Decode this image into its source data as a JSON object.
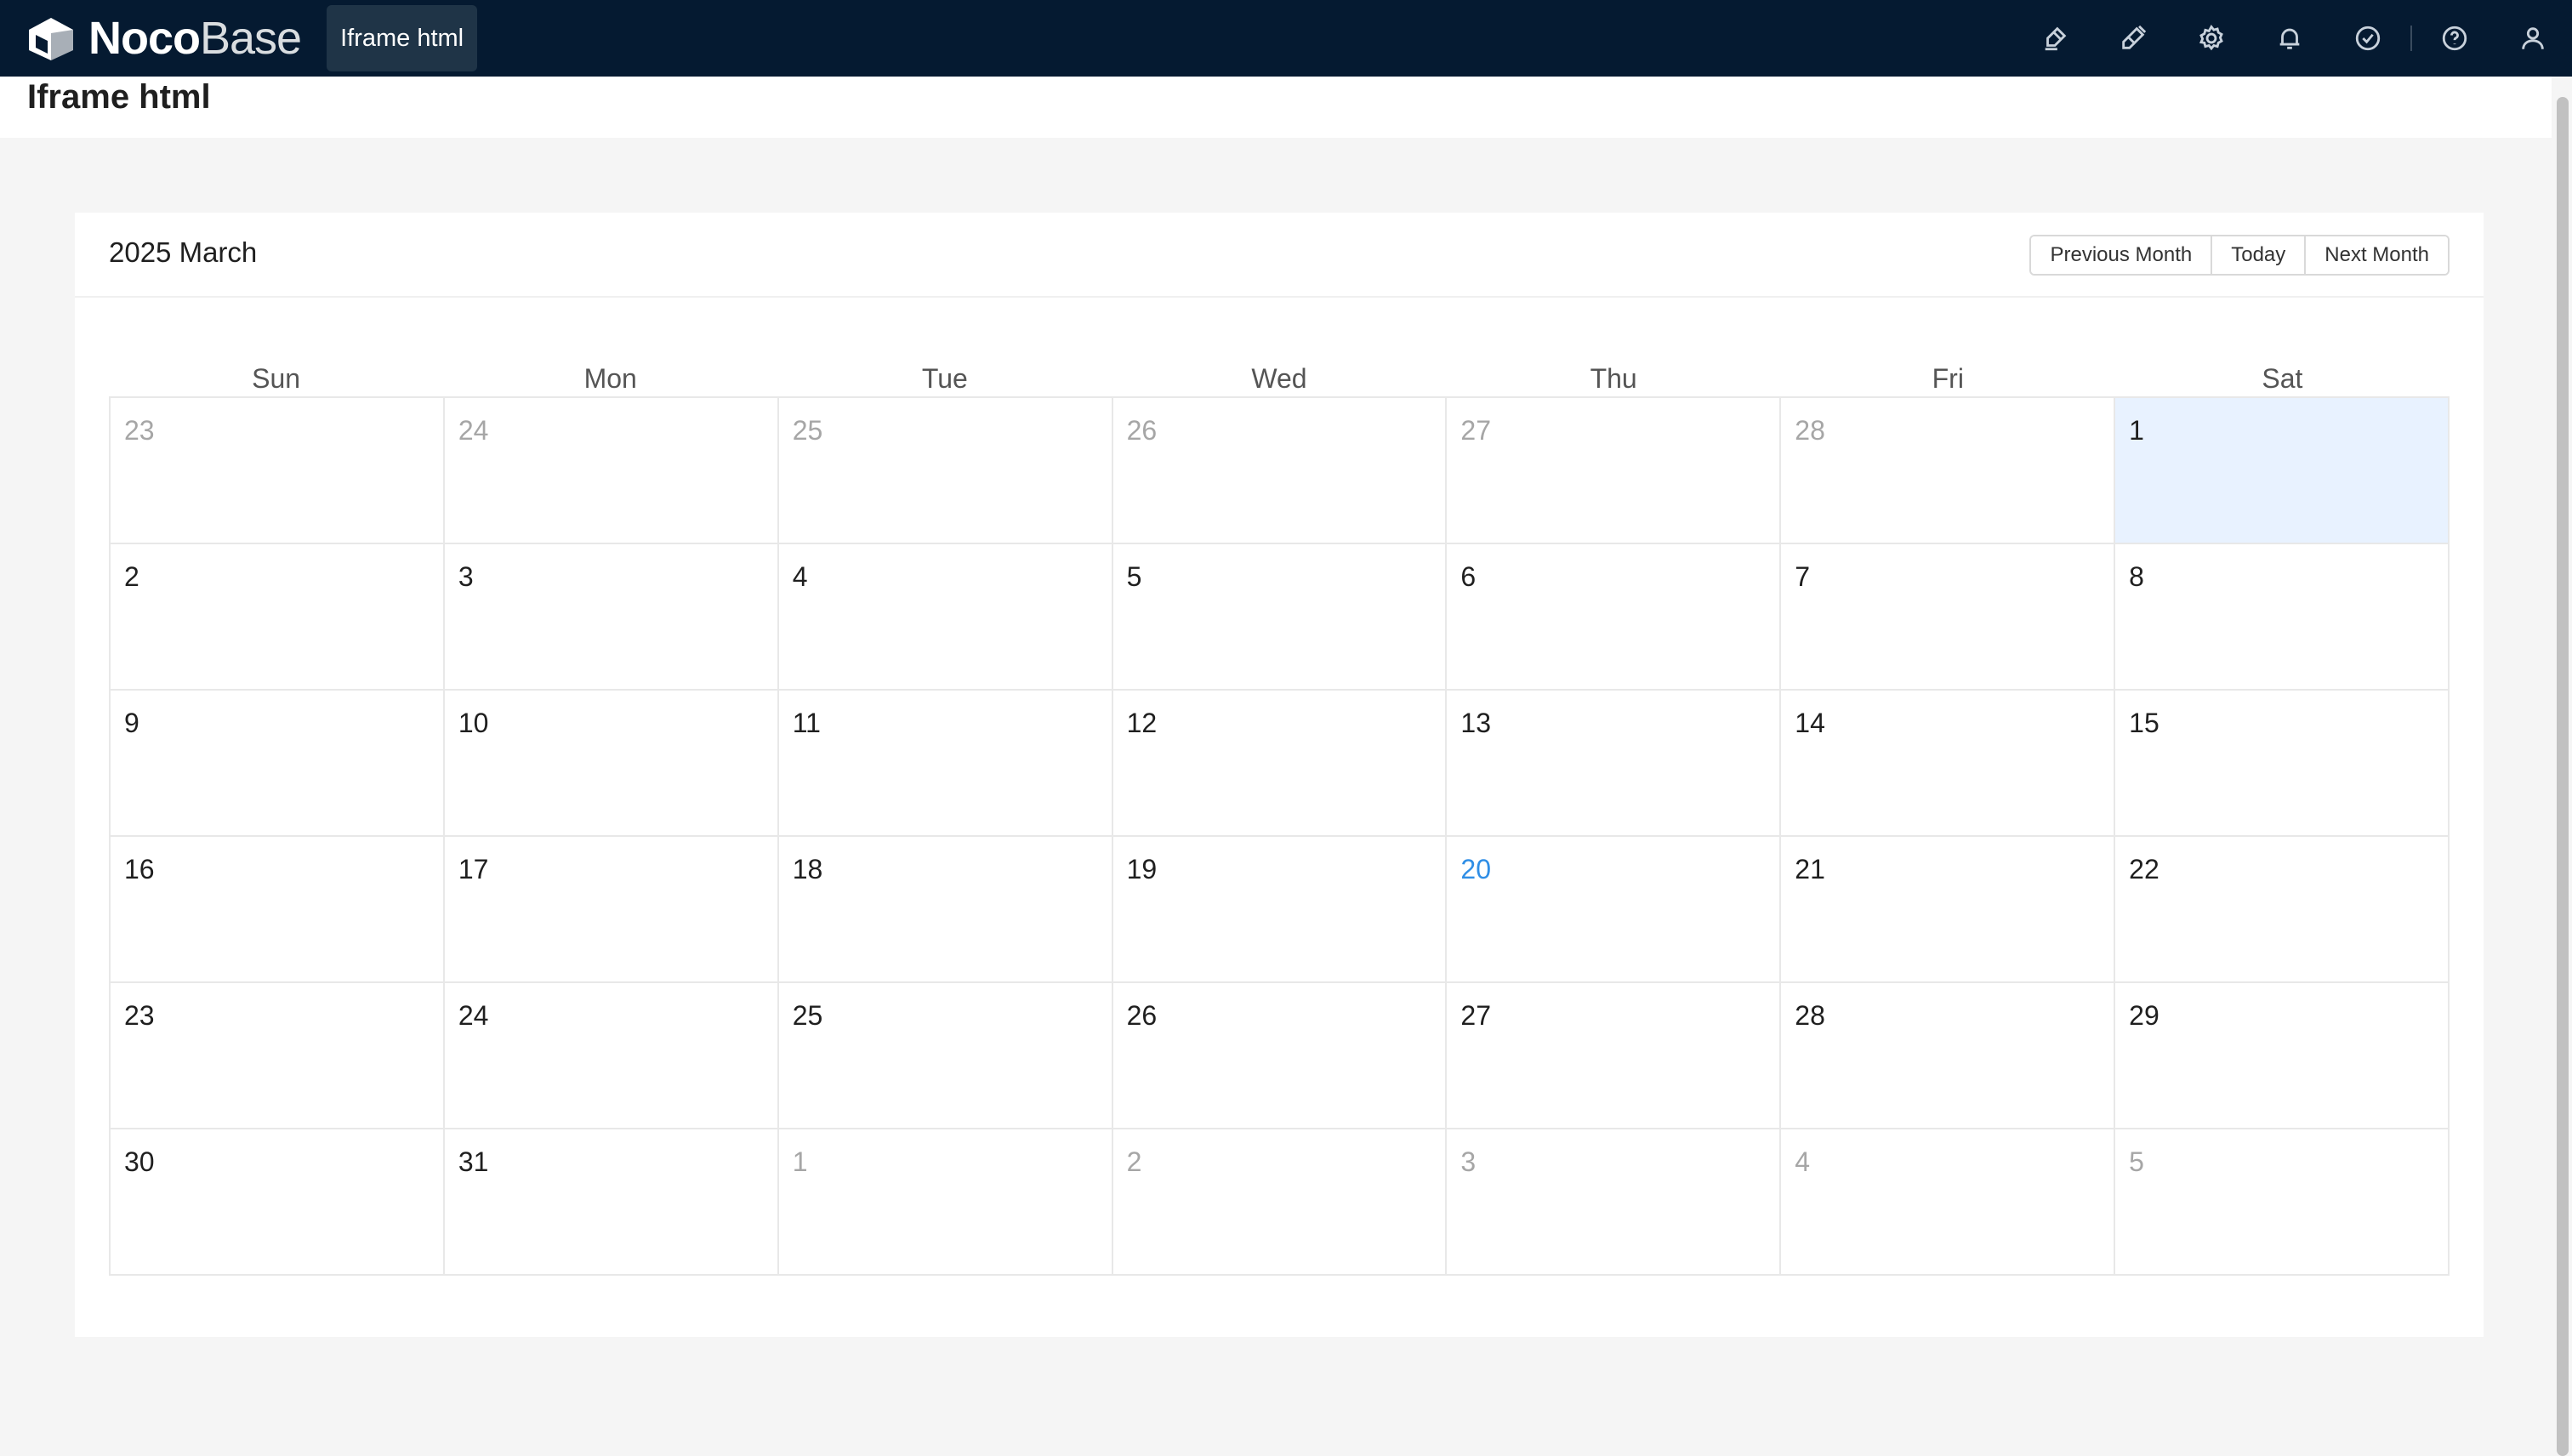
{
  "topbar": {
    "logo_bold": "Noco",
    "logo_light": "Base",
    "active_tab": "Iframe html",
    "icons": [
      "highlighter-icon",
      "plugin-icon",
      "settings-icon",
      "bell-icon",
      "check-circle-icon",
      "help-icon",
      "user-icon"
    ]
  },
  "page": {
    "title": "Iframe html"
  },
  "calendar": {
    "month_label": "2025 March",
    "buttons": {
      "prev": "Previous Month",
      "today": "Today",
      "next": "Next Month"
    },
    "weekdays": [
      "Sun",
      "Mon",
      "Tue",
      "Wed",
      "Thu",
      "Fri",
      "Sat"
    ],
    "weeks": [
      [
        {
          "d": "23",
          "o": true
        },
        {
          "d": "24",
          "o": true
        },
        {
          "d": "25",
          "o": true
        },
        {
          "d": "26",
          "o": true
        },
        {
          "d": "27",
          "o": true
        },
        {
          "d": "28",
          "o": true
        },
        {
          "d": "1",
          "o": false,
          "selected": true
        }
      ],
      [
        {
          "d": "2"
        },
        {
          "d": "3"
        },
        {
          "d": "4"
        },
        {
          "d": "5"
        },
        {
          "d": "6"
        },
        {
          "d": "7"
        },
        {
          "d": "8"
        }
      ],
      [
        {
          "d": "9"
        },
        {
          "d": "10"
        },
        {
          "d": "11"
        },
        {
          "d": "12"
        },
        {
          "d": "13"
        },
        {
          "d": "14"
        },
        {
          "d": "15"
        }
      ],
      [
        {
          "d": "16"
        },
        {
          "d": "17"
        },
        {
          "d": "18"
        },
        {
          "d": "19"
        },
        {
          "d": "20",
          "today": true
        },
        {
          "d": "21"
        },
        {
          "d": "22"
        }
      ],
      [
        {
          "d": "23"
        },
        {
          "d": "24"
        },
        {
          "d": "25"
        },
        {
          "d": "26"
        },
        {
          "d": "27"
        },
        {
          "d": "28"
        },
        {
          "d": "29"
        }
      ],
      [
        {
          "d": "30"
        },
        {
          "d": "31"
        },
        {
          "d": "1",
          "o": true
        },
        {
          "d": "2",
          "o": true
        },
        {
          "d": "3",
          "o": true
        },
        {
          "d": "4",
          "o": true
        },
        {
          "d": "5",
          "o": true
        }
      ]
    ]
  },
  "colors": {
    "topbar": "#051a31",
    "today": "#2f8ee6",
    "selected_bg": "#e8f2ff"
  }
}
